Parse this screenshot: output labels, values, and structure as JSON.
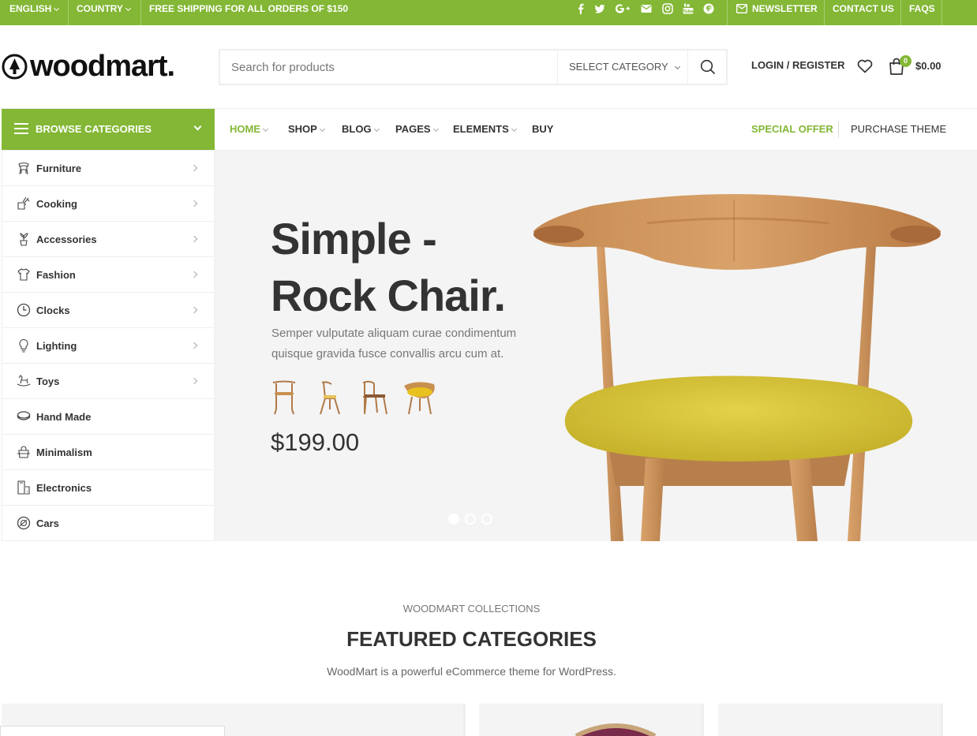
{
  "topbar": {
    "language": "ENGLISH",
    "country": "COUNTRY",
    "shipping": "FREE SHIPPING FOR ALL ORDERS OF $150",
    "social_icons": [
      "facebook-icon",
      "twitter-icon",
      "google-plus-icon",
      "email-icon",
      "instagram-icon",
      "youtube-icon",
      "pinterest-icon"
    ],
    "newsletter": "NEWSLETTER",
    "contact": "CONTACT US",
    "faqs": "FAQS"
  },
  "header": {
    "logo": "woodmart.",
    "search_placeholder": "Search for products",
    "category_select": "SELECT CATEGORY",
    "login": "LOGIN / REGISTER",
    "cart_count": "0",
    "cart_total": "$0.00"
  },
  "nav": {
    "browse": "BROWSE CATEGORIES",
    "items": [
      "HOME",
      "SHOP",
      "BLOG",
      "PAGES",
      "ELEMENTS",
      "BUY"
    ],
    "special_offer": "SPECIAL OFFER",
    "purchase": "PURCHASE THEME"
  },
  "categories": [
    "Furniture",
    "Cooking",
    "Accessories",
    "Fashion",
    "Clocks",
    "Lighting",
    "Toys",
    "Hand Made",
    "Minimalism",
    "Electronics",
    "Cars"
  ],
  "hero": {
    "title_line1": "Simple -",
    "title_line2": "Rock Chair.",
    "description": "Semper vulputate aliquam curae condimentum quisque gravida fusce convallis arcu cum at.",
    "price": "$199.00",
    "slide_count": 3,
    "active_slide": 1
  },
  "featured": {
    "subtitle": "WOODMART COLLECTIONS",
    "title": "FEATURED CATEGORIES",
    "description": "WoodMart is a powerful eCommerce theme for WordPress."
  },
  "colors": {
    "accent": "#83b735",
    "text": "#333333",
    "hero_bg": "#f4f4f4"
  }
}
